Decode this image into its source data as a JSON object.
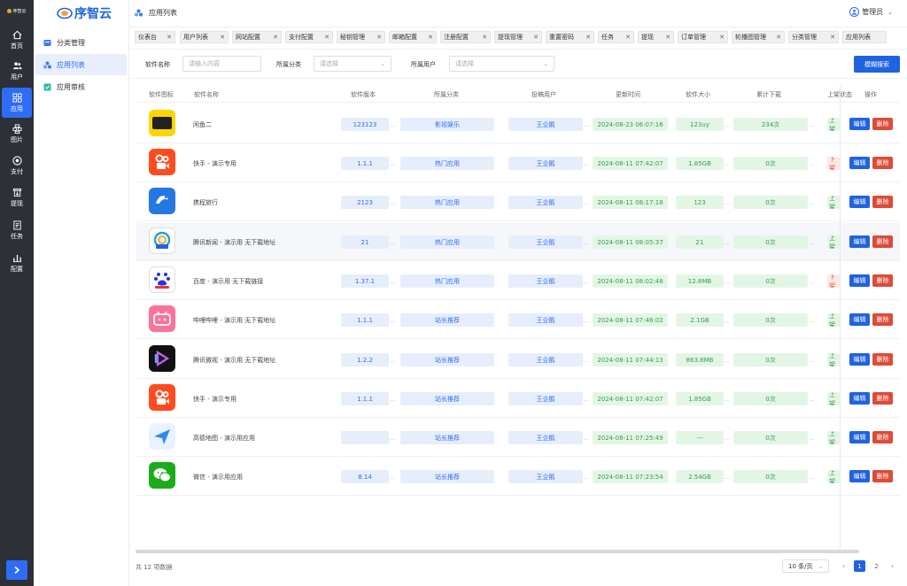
{
  "rail": {
    "logo_text": "序智云",
    "items": [
      {
        "label": "首页",
        "icon": "home-icon"
      },
      {
        "label": "用户",
        "icon": "users-icon"
      },
      {
        "label": "应用",
        "icon": "apps-icon"
      },
      {
        "label": "图片",
        "icon": "image-icon"
      },
      {
        "label": "支付",
        "icon": "pay-icon"
      },
      {
        "label": "提现",
        "icon": "withdraw-icon"
      },
      {
        "label": "任务",
        "icon": "task-icon"
      },
      {
        "label": "配置",
        "icon": "config-icon"
      }
    ],
    "toggle_icon": "chevron-right-icon"
  },
  "sidebar": {
    "brand": "序智云",
    "items": [
      {
        "label": "分类管理",
        "icon": "category-icon"
      },
      {
        "label": "应用列表",
        "icon": "app-list-icon"
      },
      {
        "label": "应用审核",
        "icon": "review-icon"
      }
    ]
  },
  "header": {
    "breadcrumb": "应用列表",
    "user": "管理员"
  },
  "tags": [
    "仪表台",
    "用户列表",
    "网站配置",
    "支付配置",
    "秘钥管理",
    "邮箱配置",
    "注册配置",
    "提现管理",
    "重置密码",
    "任务",
    "提现",
    "订单管理",
    "轮播图管理",
    "分类管理",
    "应用列表"
  ],
  "filter": {
    "name_label": "软件名称",
    "name_placeholder": "请输入内容",
    "category_label": "所属分类",
    "category_placeholder": "请选择",
    "user_label": "所属用户",
    "user_placeholder": "请选择",
    "search_button": "模糊搜索"
  },
  "table": {
    "headers": [
      "软件图标",
      "软件名称",
      "软件版本",
      "所属分类",
      "投稿用户",
      "更新时间",
      "软件大小",
      "累计下载",
      "上架状态",
      "操作"
    ],
    "rows": [
      {
        "name": "闲鱼二",
        "version": "123123",
        "category": "影视娱乐",
        "user": "王企鹅",
        "time": "2024-08-23 06:07:16",
        "size": "123uy",
        "downloads": "234次",
        "status": "上架",
        "status_color": "green",
        "icon": "xianyu-icon"
      },
      {
        "name": "快手 - 演示专用",
        "version": "1.1.1",
        "category": "热门应用",
        "user": "王企鹅",
        "time": "2024-08-11 07:42:07",
        "size": "1.85GB",
        "downloads": "0次",
        "status": "下架",
        "status_color": "red",
        "icon": "kuaishou-icon"
      },
      {
        "name": "携程旅行",
        "version": "2123",
        "category": "热门应用",
        "user": "王企鹅",
        "time": "2024-08-11 08:17:18",
        "size": "123",
        "downloads": "0次",
        "status": "上架",
        "status_color": "green",
        "icon": "ctrip-icon"
      },
      {
        "name": "腾讯新闻 - 演示用 无下载地址",
        "version": "21",
        "category": "热门应用",
        "user": "王企鹅",
        "time": "2024-08-11 08:05:37",
        "size": "21",
        "downloads": "0次",
        "status": "上架",
        "status_color": "green",
        "icon": "tencent-news-icon"
      },
      {
        "name": "百度 - 演示用 无下载链接",
        "version": "1.37.1",
        "category": "热门应用",
        "user": "王企鹅",
        "time": "2024-08-11 08:02:48",
        "size": "12.8MB",
        "downloads": "0次",
        "status": "下架",
        "status_color": "red",
        "icon": "baidu-icon"
      },
      {
        "name": "哔哩哔哩 - 演示用 无下载地址",
        "version": "1.1.1",
        "category": "站长推荐",
        "user": "王企鹅",
        "time": "2024-08-11 07:46:02",
        "size": "2.1GB",
        "downloads": "0次",
        "status": "上架",
        "status_color": "green",
        "icon": "bilibili-icon"
      },
      {
        "name": "腾讯微视 - 演示用 无下载地址",
        "version": "1.2.2",
        "category": "站长推荐",
        "user": "王企鹅",
        "time": "2024-08-11 07:44:13",
        "size": "863.8MB",
        "downloads": "0次",
        "status": "上架",
        "status_color": "green",
        "icon": "weishi-icon"
      },
      {
        "name": "快手 - 演示专用",
        "version": "1.1.1",
        "category": "站长推荐",
        "user": "王企鹅",
        "time": "2024-08-11 07:42:07",
        "size": "1.85GB",
        "downloads": "0次",
        "status": "上架",
        "status_color": "green",
        "icon": "kuaishou-icon"
      },
      {
        "name": "高德地图 - 演示用应用",
        "version": "",
        "category": "站长推荐",
        "user": "王企鹅",
        "time": "2024-08-11 07:25:49",
        "size": "---",
        "downloads": "0次",
        "status": "上架",
        "status_color": "green",
        "icon": "amap-icon"
      },
      {
        "name": "微信 - 演示用应用",
        "version": "8.14",
        "category": "站长推荐",
        "user": "王企鹅",
        "time": "2024-08-11 07:23:54",
        "size": "2.54GB",
        "downloads": "0次",
        "status": "上架",
        "status_color": "green",
        "icon": "wechat-icon"
      }
    ],
    "edit_label": "编辑",
    "delete_label": "删除"
  },
  "pagination": {
    "total": "共 12 项数据",
    "page_size": "10 条/页",
    "pages": [
      "1",
      "2"
    ],
    "current": "1"
  },
  "colors": {
    "primary": "#1f63e0",
    "danger": "#dd4b39",
    "rail": "#2d3037"
  }
}
